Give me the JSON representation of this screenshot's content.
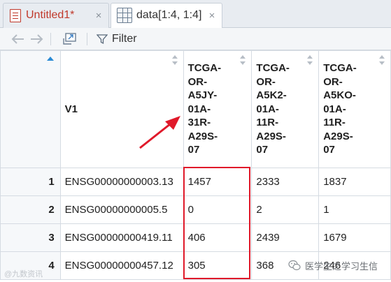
{
  "tabs": [
    {
      "label": "Untitled1*",
      "close": "×",
      "modified": true
    },
    {
      "label": "data[1:4, 1:4]",
      "close": "×",
      "active": true
    }
  ],
  "toolbar": {
    "filter_label": "Filter"
  },
  "table": {
    "columns": [
      "V1",
      "TCGA-\nOR-\nA5JY-\n01A-\n31R-\nA29S-\n07",
      "TCGA-\nOR-\nA5K2-\n01A-\n11R-\nA29S-\n07",
      "TCGA-\nOR-\nA5KO-\n01A-\n11R-\nA29S-\n07"
    ],
    "rows": [
      {
        "n": "1",
        "cells": [
          "ENSG00000000003.13",
          "1457",
          "2333",
          "1837"
        ]
      },
      {
        "n": "2",
        "cells": [
          "ENSG00000000005.5",
          "0",
          "2",
          "1"
        ]
      },
      {
        "n": "3",
        "cells": [
          "ENSG00000000419.11",
          "406",
          "2439",
          "1679"
        ]
      },
      {
        "n": "4",
        "cells": [
          "ENSG00000000457.12",
          "305",
          "368",
          "246"
        ]
      }
    ]
  },
  "watermark": {
    "left": "@九数资讯",
    "right": "医学生之学习生信"
  },
  "colors": {
    "accent_red": "#e0192a",
    "sort_blue": "#2a8ad4",
    "tab_modified": "#c0392b"
  },
  "icons": [
    "doc-icon",
    "grid-icon",
    "back-arrow-icon",
    "forward-arrow-icon",
    "popout-icon",
    "filter-icon",
    "close-icon",
    "wechat-icon"
  ]
}
